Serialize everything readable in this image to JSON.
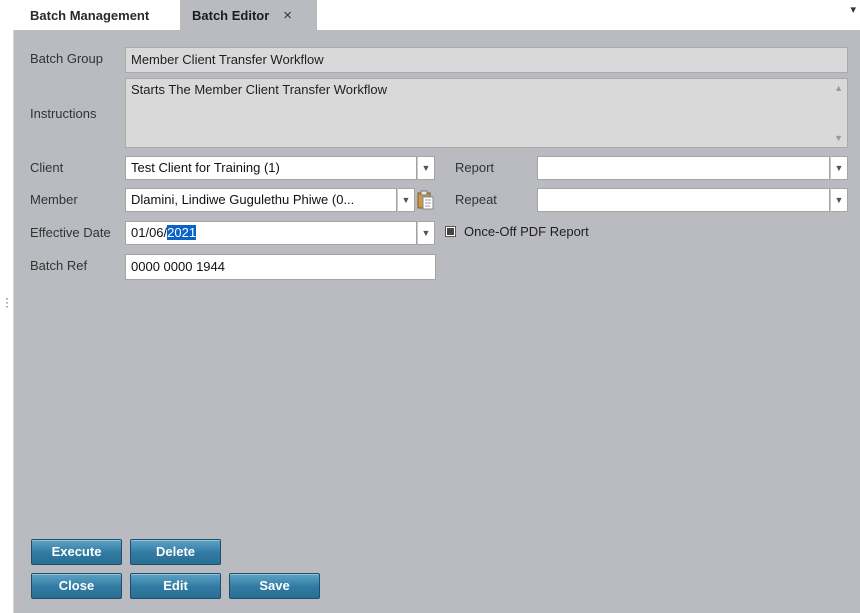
{
  "tabs": [
    {
      "label": "Batch Management",
      "active": false
    },
    {
      "label": "Batch Editor",
      "active": true,
      "closable": true
    }
  ],
  "tab_close_glyph": "×",
  "tab_menu_glyph": "▾",
  "form": {
    "batch_group": {
      "label": "Batch Group",
      "value": "Member Client Transfer Workflow"
    },
    "instructions": {
      "label": "Instructions",
      "value": "Starts The Member Client Transfer Workflow"
    },
    "client": {
      "label": "Client",
      "value": "Test Client for Training (1)"
    },
    "member": {
      "label": "Member",
      "value": "Dlamini, Lindiwe Gugulethu Phiwe (0..."
    },
    "effective_date": {
      "label": "Effective Date",
      "value_prefix": "01/06/",
      "value_selected": "2021"
    },
    "batch_ref": {
      "label": "Batch Ref",
      "value": "0000 0000 1944"
    },
    "report": {
      "label": "Report",
      "value": ""
    },
    "repeat": {
      "label": "Repeat",
      "value": ""
    },
    "once_off_pdf": {
      "label": "Once-Off PDF Report",
      "checked": true
    }
  },
  "buttons": {
    "execute": "Execute",
    "delete": "Delete",
    "close": "Close",
    "edit": "Edit",
    "save": "Save"
  },
  "icons": {
    "dropdown": "chevron-down-icon",
    "paste": "clipboard-icon",
    "close": "close-icon"
  },
  "colors": {
    "background": "#b9bbc1",
    "button": "#2f7aa2",
    "selection": "#0a63c8"
  }
}
